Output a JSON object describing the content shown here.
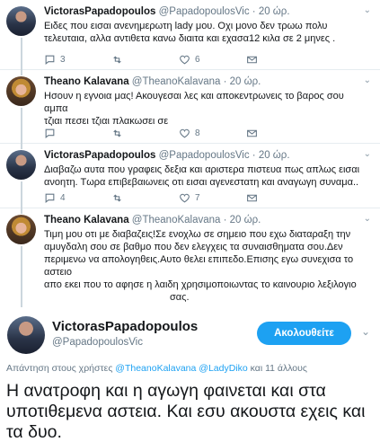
{
  "tweets": [
    {
      "name": "VictorasPapadopoulos",
      "handle": "@PapadopoulosVic",
      "time": "· 20 ώρ.",
      "lines": [
        "Ειδες που εισαι ανενημερωτη  lady μου. Οχι μονο δεν τρωω πολυ",
        "τελευταια, αλλα αντιθετα κανω διαιτα και εχασα12 κιλα σε 2 μηνες ."
      ],
      "replies": "3",
      "retweets": "",
      "likes": "6"
    },
    {
      "name": "Theano Kalavana",
      "handle": "@TheanoKalavana",
      "time": "· 20 ώρ.",
      "lines": [
        "Ησουν η εγνοια μας! Ακουγεσαι λες και αποκεντρωνεις το βαρος σου αμπα",
        "τζιαι πεσει τζιαι πλακωσει σε"
      ],
      "replies": "",
      "retweets": "",
      "likes": "8"
    },
    {
      "name": "VictorasPapadopoulos",
      "handle": "@PapadopoulosVic",
      "time": "· 20 ώρ.",
      "lines": [
        "Διαβαζω αυτα που γραφεις δεξια και αριστερα πιστευα πως απλως εισαι",
        "ανοητη. Τωρα επιβεβαιωνεις οτι εισαι αγενεστατη και αναγωγη συναμα.."
      ],
      "replies": "4",
      "retweets": "",
      "likes": "7"
    },
    {
      "name": "Theano Kalavana",
      "handle": "@TheanoKalavana",
      "time": "· 20 ώρ.",
      "lines": [
        "Τιμη μου οτι με διαβαζεις!Σε ενοχλω σε σημειο που εχω διαταραξη την",
        "αμυγδαλη σου σε βαθμο που δεν ελεγχεις τα συναισθηματα σου.Δεν",
        "περιμενω να απολογηθεις.Αυτο θελει επιπεδο.Επισης εγω συνεχισα το αστειο",
        "απο εκει που το αφησε η λαιδη χρησιμοποιωντας το καινουριο λεξιλογιο",
        "σας."
      ],
      "replies": "",
      "retweets": "",
      "likes": ""
    }
  ],
  "main": {
    "name": "VictorasPapadopoulos",
    "handle": "@PapadopoulosVic",
    "follow_label": "Ακολουθείτε",
    "reply_prefix": "Απάντηση στους χρήστες ",
    "reply_user1": "@TheanoKalavana",
    "reply_user2": "@LadyDiko",
    "reply_suffix": " και 11 άλλους",
    "text": "Η ανατροφη και η αγωγη φαινεται και στα υποτιθεμενα αστεια. Και εσυ ακουστα εχεις και τα δυο."
  },
  "colors": {
    "accent": "#1da1f2",
    "muted": "#657786",
    "retweet_green": "#17bf63"
  }
}
